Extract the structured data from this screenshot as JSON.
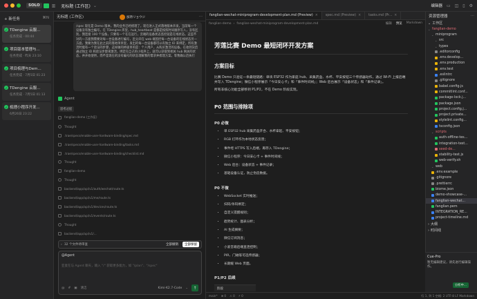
{
  "window": {
    "title": "无标题 (工作区)",
    "solo": "SOLO"
  },
  "sidebar": {
    "new_task": "新任务",
    "new_task_shortcut": "⌘N",
    "tasks": [
      {
        "title": "TDengine 云服...",
        "status": "任务完成 · 00:44"
      },
      {
        "title": "项目版本管理与...",
        "status": "任务完成 · 昨天 23:10"
      },
      {
        "title": "项目梳理与Dem...",
        "status": "任务完成 · 7月5日 01:23"
      },
      {
        "title": "TDengine 云服...",
        "status": "任务完成 · 7月5日 01:13"
      },
      {
        "title": "梳理小程序开发...",
        "status": "6月26日 23:22"
      }
    ]
  },
  "chat": {
    "user_name": "加持リョウジ",
    "user_message": "/spec 现在是 Demo 版本，我的业务已经梳理了，现在进入正式落地版本开发，当前每一个设备没有独立编号，在 TDengine 库里，hub_heartbeat 是都是按照时间顺序写入，没有区别，我连接 100 个设备，只要有一个在在运行，云端的设备状态监控就是在线状态。这些不对的一方面我需要对每一台设备进行编号，区分开在 web 端监控每一台设备的在线状态另一方面，我要为我在此之前的落地项目里，发出的每一台设备都可以有独立 ID 来绑定。所有激活时能有一个验证的步骤，这样做的终极目的是：个人用户，从购买激活的设备，在收到货后通过独立 ID 和验证步骤来激活，绑定在自己的小程序上，就可以获取到相关 hub 网关的状态，并开始使用，而不是现在的没有编号的状态理解我的需求并梳理方案，等我确认后执行",
    "agent_label": "Agent",
    "think_label": "思考过程",
    "steps": [
      {
        "kind": "file",
        "text": "fanglian-demo (工作区)"
      },
      {
        "kind": "think",
        "text": "Thought"
      },
      {
        "kind": "file",
        "text": ".trae/specs/enable-user-hardware-binding/spec.md"
      },
      {
        "kind": "file",
        "text": ".trae/specs/enable-user-hardware-binding/tasks.md"
      },
      {
        "kind": "file",
        "text": ".trae/specs/enable-user-hardware-binding/checklist.md"
      },
      {
        "kind": "think",
        "text": "Thought"
      },
      {
        "kind": "file",
        "text": "fanglian-demo"
      },
      {
        "kind": "think",
        "text": "Thought"
      },
      {
        "kind": "file",
        "text": "backend/app/api/v1/auth/wechat/route.ts"
      },
      {
        "kind": "file",
        "text": "backend/app/api/v1/me/route.ts"
      },
      {
        "kind": "file",
        "text": "backend/app/api/v1/devices/route.ts"
      },
      {
        "kind": "file",
        "text": "backend/app/api/v1/events/route.ts"
      },
      {
        "kind": "think",
        "text": "Thought"
      },
      {
        "kind": "file",
        "text": "backend/app/api/v1/..."
      }
    ],
    "pending_text": "32 个文件待审查",
    "reject_all": "全部撤销",
    "accept_all": "全部保留",
    "input_agent": "@Agent",
    "input_placeholder": "亚麦在与 Agent 聊天，输入 \"/\" 获取更多能力，如 \"/plan\"、\"/spec\"",
    "clean_label": "清洁",
    "model": "Kimi-K2.7-Code"
  },
  "editor": {
    "top_label": "编辑器",
    "tabs": [
      {
        "label": "fanglian-wechat-miniprogram-development-plan.md (Preview)",
        "active": true
      },
      {
        "label": "spec.md (Preview)",
        "active": false
      },
      {
        "label": "tasks.md (Pr...",
        "active": false
      }
    ],
    "breadcrumb": [
      "fanglian-demo",
      "fanglian-wechat-miniprogram-development-plan.md"
    ],
    "crumb_actions": [
      "编辑",
      "预览",
      "Markdown"
    ],
    "h1": "芳莲比赛 Demo 最短闭环开发方案",
    "goal_h": "方案目标",
    "goal_p": "比赛 Demo 只验证一条最短链路：单块 ESP32 作为家庭 hub、采集药盒、水杯、平安按钮三个传感器动作，通过 Wi-Fi 上报后端并写入 TDengine；微信小程序展示「今日安心卡」和「事件时间线」；Web 后台展示「设备状态」和「事件记录」。",
    "goal_p2": "所有非核心功能全部移到 P1/P2，不在 Demo 阶段实现。",
    "p0_h": "P0 范围与排除项",
    "must_h": "P0 必做",
    "must": [
      "单 ESP32 hub 采集药盒开合、水杯拿起、平安按钮；",
      "RGB 灯环作为本地状态反馈；",
      "事件经 HTTPS 写入后端，再存入 TDengine；",
      "微信小程序：今日安心卡 + 事件时间线；",
      "Web 后台：设备状态 + 事件记录；",
      "基础设备认证，防止伪造数据。"
    ],
    "not_h": "P0 不做",
    "not": [
      "WebSocket 实时推送；",
      "扫码/条码绑定；",
      "自定义提醒规则；",
      "趋势统计、图表分析；",
      "AI 生成摘要；",
      "微信订阅消息；",
      "小爱音箱后端直连控制；",
      "PIR、门磁等可选传感器；",
      "长期缓 Web 页面。"
    ],
    "p1_h": "P1/P2 后续",
    "table_head": "阶段"
  },
  "status": {
    "branch": "main*",
    "items": [
      "⊗ 0",
      "⚠ 0",
      "⚡ 0"
    ],
    "right": "行 1, 列 1   空格: 2   UTF-8   LF   Markdown"
  },
  "explorer": {
    "title": "资源管理器",
    "section": "工作区",
    "rows": [
      {
        "text": "fanglian-demo",
        "depth": 0,
        "kind": "folder",
        "color": "red"
      },
      {
        "text": "miniprogram",
        "depth": 1,
        "kind": "folder",
        "color": "none"
      },
      {
        "text": "src",
        "depth": 2,
        "kind": "folder",
        "color": "none"
      },
      {
        "text": "types",
        "depth": 2,
        "kind": "folder",
        "color": "none"
      },
      {
        "text": ".editorconfig",
        "depth": 2,
        "kind": "file",
        "color": "none"
      },
      {
        "text": ".env.develop...",
        "depth": 2,
        "kind": "file",
        "color": "yel"
      },
      {
        "text": ".env.production",
        "depth": 2,
        "kind": "file",
        "color": "yel"
      },
      {
        "text": ".env.test",
        "depth": 2,
        "kind": "file",
        "color": "yel"
      },
      {
        "text": ".eslintrc",
        "depth": 2,
        "kind": "file",
        "color": "blu"
      },
      {
        "text": ".gitignore",
        "depth": 2,
        "kind": "file",
        "color": "none"
      },
      {
        "text": "babel.config.js",
        "depth": 2,
        "kind": "file",
        "color": "yel"
      },
      {
        "text": "commitlint.conf...",
        "depth": 2,
        "kind": "file",
        "color": "yel"
      },
      {
        "text": "package-lock.j...",
        "depth": 2,
        "kind": "file",
        "color": "grn"
      },
      {
        "text": "package.json",
        "depth": 2,
        "kind": "file",
        "color": "grn"
      },
      {
        "text": "project.config.j...",
        "depth": 2,
        "kind": "file",
        "color": "grn"
      },
      {
        "text": "project.private...",
        "depth": 2,
        "kind": "file",
        "color": "grn"
      },
      {
        "text": "stylelint.config...",
        "depth": 2,
        "kind": "file",
        "color": "yel"
      },
      {
        "text": "tsconfig.json",
        "depth": 2,
        "kind": "file",
        "color": "blu"
      },
      {
        "text": "scripts",
        "depth": 1,
        "kind": "folder",
        "color": "red"
      },
      {
        "text": "auth-offline-tes...",
        "depth": 2,
        "kind": "file",
        "color": "grn"
      },
      {
        "text": "integration-test...",
        "depth": 2,
        "kind": "file",
        "color": "grn"
      },
      {
        "text": "seed-de...",
        "depth": 2,
        "kind": "file",
        "color": "red"
      },
      {
        "text": "stability-test.js",
        "depth": 2,
        "kind": "file",
        "color": "yel"
      },
      {
        "text": "web-verify.sh",
        "depth": 2,
        "kind": "file",
        "color": "grn"
      },
      {
        "text": "web",
        "depth": 1,
        "kind": "folder",
        "color": "none"
      },
      {
        "text": ".env.example",
        "depth": 1,
        "kind": "file",
        "color": "yel"
      },
      {
        "text": ".gitignore",
        "depth": 1,
        "kind": "file",
        "color": "none"
      },
      {
        "text": ".prettierrc",
        "depth": 1,
        "kind": "file",
        "color": "none"
      },
      {
        "text": "biome.json",
        "depth": 1,
        "kind": "file",
        "color": "grn"
      },
      {
        "text": "demo-showcase-...",
        "depth": 1,
        "kind": "file",
        "color": "blu"
      },
      {
        "text": "fanglian-wechat...",
        "depth": 1,
        "kind": "file",
        "color": "blu",
        "selected": true
      },
      {
        "text": "fanglian.pem",
        "depth": 1,
        "kind": "file",
        "color": "grn"
      },
      {
        "text": "INTEGRATION_RE...",
        "depth": 1,
        "kind": "file",
        "color": "blu"
      },
      {
        "text": "project-timeline.md",
        "depth": 1,
        "kind": "file",
        "color": "blu"
      }
    ],
    "outline": "大纲",
    "timeline": "时间线"
  },
  "cue": {
    "title": "Cue-Pro",
    "desc": "暂无编辑建议，请先进行编辑操作。",
    "action": "分析中..."
  },
  "colors": {
    "green": "#22c55e",
    "red": "#e06c75"
  }
}
